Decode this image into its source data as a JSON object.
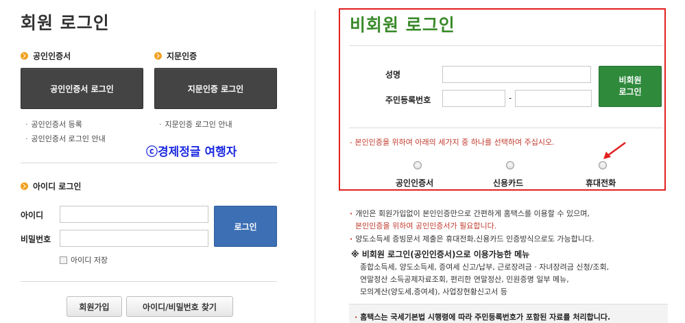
{
  "member": {
    "title": "회원 로그인",
    "cert_section": "공인인증서",
    "cert_login_button": "공인인증서 로그인",
    "cert_links": [
      "공인인증서 등록",
      "공인인증서 로그인 안내"
    ],
    "finger_section": "지문인증",
    "finger_login_button": "지문인증 로그인",
    "finger_links": [
      "지문인증 로그인 안내"
    ],
    "id_section": "아이디 로그인",
    "id_label": "아이디",
    "password_label": "비밀번호",
    "login_button": "로그인",
    "save_id_label": "아이디 저장",
    "signup_button": "회원가입",
    "find_button": "아이디/비밀번호 찾기"
  },
  "watermark": "ⓒ경제정글 여행자",
  "guest": {
    "title": "비회원 로그인",
    "name_label": "성명",
    "rrn_label": "주민등록번호",
    "rrn_separator": "-",
    "login_button_line1": "비회원",
    "login_button_line2": "로그인",
    "instruction": "- 본인인증을 위하여 아래의 세가지 중 하나를 선택하여 주십시오.",
    "options": [
      "공인인증서",
      "신용카드",
      "휴대전화"
    ]
  },
  "info": {
    "line1": "개인은 회원가입없이 본인인증만으로 간편하게 홈택스를 이용할 수 있으며,",
    "line2": "본인인증을 위하여 공인인증서가 필요합니다.",
    "line3": "양도소득세 증빙문서 제출은 휴대전화,신용카드 인증방식으로도 가능합니다.",
    "notice_title": "※ 비회원 로그인(공인인증서)으로 이용가능한 메뉴",
    "menu_lines": [
      "종합소득세, 양도소득세, 증여세 신고/납부, 근로장려금 · 자녀장려금 신청/조회,",
      "연말정산 소득공제자료조회, 편리한 연말정산, 민원증명 일부 메뉴,",
      "모의계산(양도세,증여세), 사업장현황신고서 등"
    ],
    "bottom_notice": "홈택스는 국세기본법 시행령에 따라 주민등록번호가 포함된 자료를 처리합니다."
  },
  "colors": {
    "accent_green": "#3a8a2a",
    "accent_blue": "#3c6fb4",
    "frame_red": "#e0201f",
    "arrow_red": "#e0201f",
    "bullet_orange": "#f0a020"
  }
}
